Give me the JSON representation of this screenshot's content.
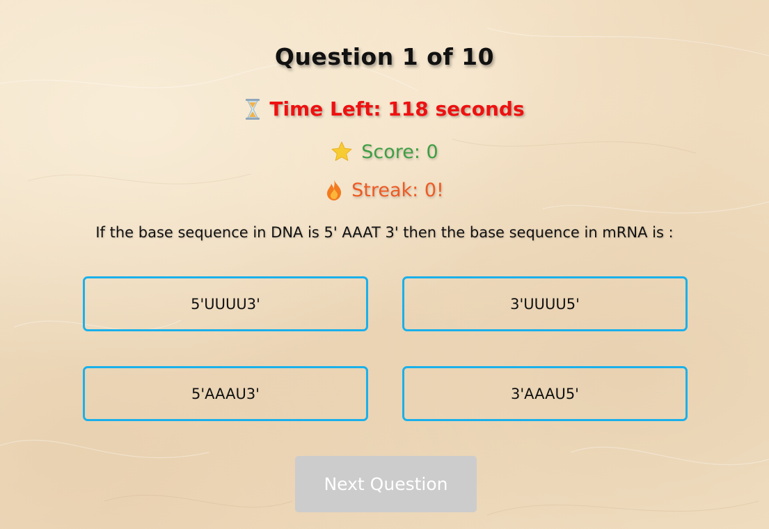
{
  "quiz": {
    "title": "Question 1 of 10",
    "timer": {
      "icon": "hourglass-icon",
      "text": "Time Left: 118 seconds",
      "color": "#ee1111"
    },
    "score": {
      "icon": "star-icon",
      "text": "Score: 0",
      "color": "#3e9e45"
    },
    "streak": {
      "icon": "fire-icon",
      "text": "Streak: 0!",
      "color": "#ee5a24"
    },
    "question": "If the base sequence in DNA is 5' AAAT 3' then the base sequence in mRNA is :",
    "options": [
      "5'UUUU3'",
      "3'UUUU5'",
      "5'AAAU3'",
      "3'AAAU5'"
    ],
    "option_border_color": "#1ab0ea",
    "next_button": {
      "label": "Next Question",
      "state": "disabled",
      "color": "#cccccc"
    }
  }
}
